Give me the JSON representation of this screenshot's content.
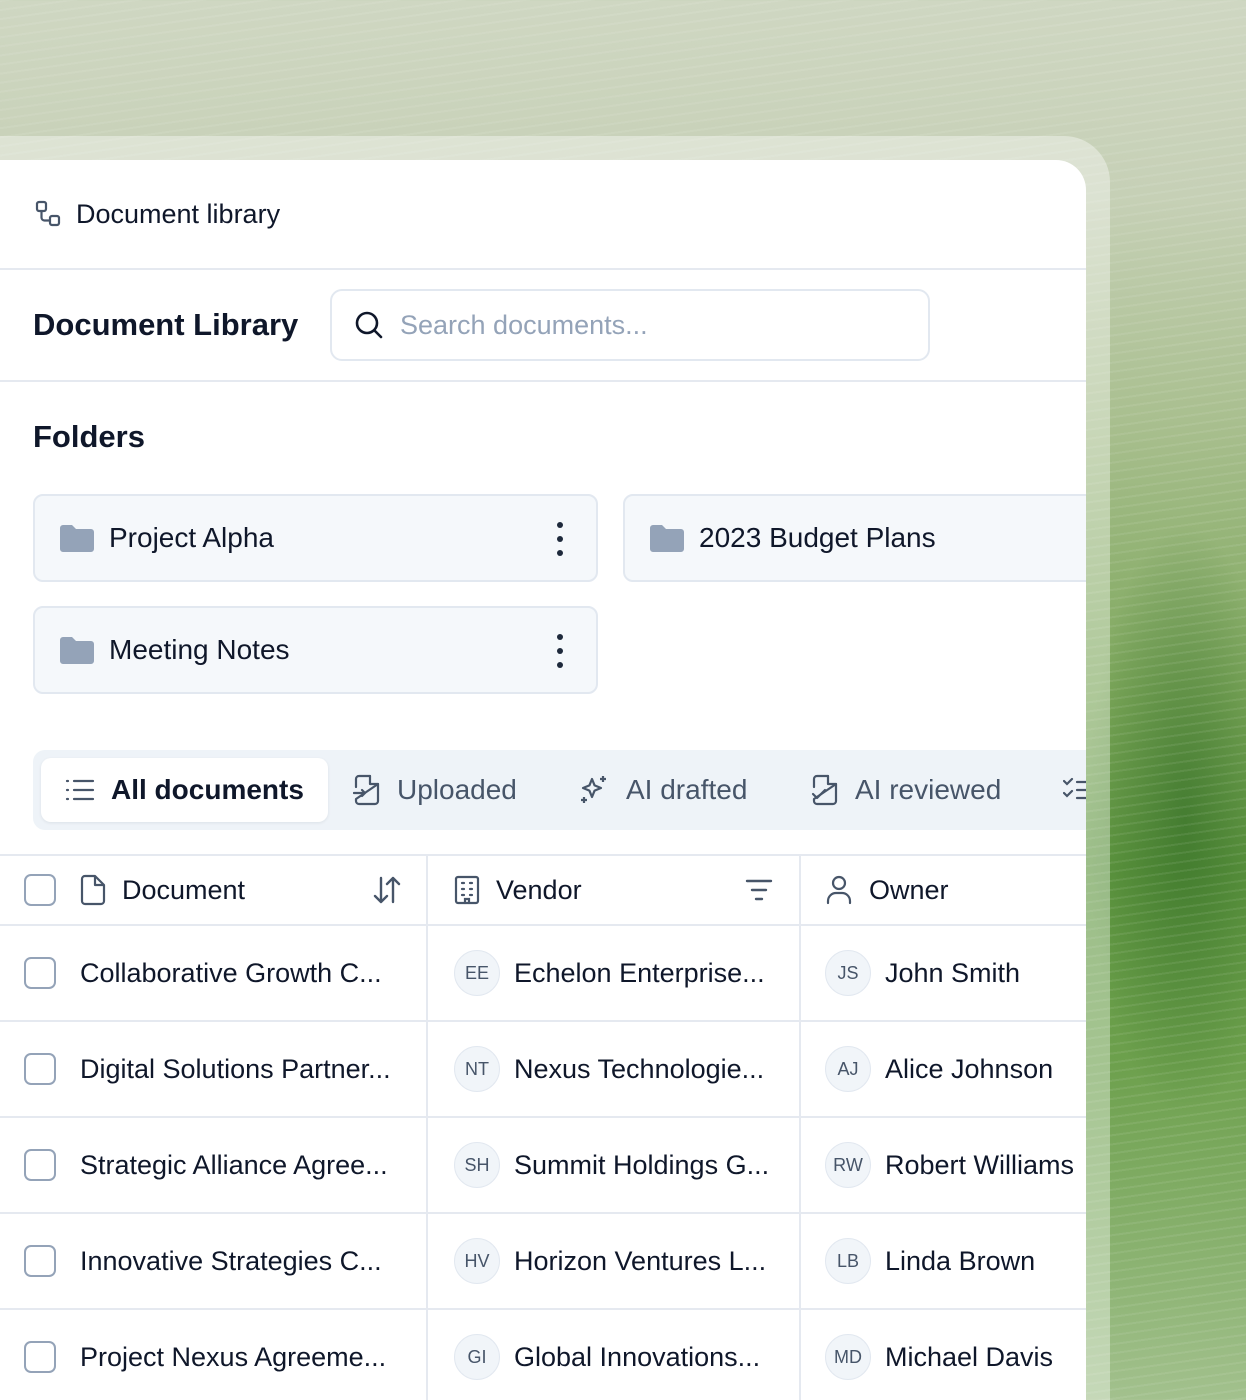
{
  "breadcrumb": {
    "label": "Document library"
  },
  "header": {
    "title": "Document Library",
    "search_placeholder": "Search documents..."
  },
  "folders": {
    "title": "Folders",
    "items": [
      {
        "name": "Project Alpha"
      },
      {
        "name": "2023 Budget Plans"
      },
      {
        "name": "Meeting Notes"
      }
    ]
  },
  "tabs": [
    {
      "label": "All documents",
      "icon": "list-icon",
      "active": true
    },
    {
      "label": "Uploaded",
      "icon": "file-upload-icon",
      "active": false
    },
    {
      "label": "AI drafted",
      "icon": "sparkle-icon",
      "active": false
    },
    {
      "label": "AI reviewed",
      "icon": "file-check-icon",
      "active": false
    }
  ],
  "table": {
    "columns": [
      {
        "label": "Document",
        "icon": "document-icon",
        "action": "sort-icon"
      },
      {
        "label": "Vendor",
        "icon": "building-icon",
        "action": "filter-icon"
      },
      {
        "label": "Owner",
        "icon": "user-icon"
      }
    ],
    "rows": [
      {
        "document": "Collaborative Growth C...",
        "vendor_initials": "EE",
        "vendor": "Echelon Enterprise...",
        "owner_initials": "JS",
        "owner": "John Smith"
      },
      {
        "document": "Digital Solutions Partner...",
        "vendor_initials": "NT",
        "vendor": "Nexus Technologie...",
        "owner_initials": "AJ",
        "owner": "Alice Johnson"
      },
      {
        "document": "Strategic Alliance Agree...",
        "vendor_initials": "SH",
        "vendor": "Summit Holdings G...",
        "owner_initials": "RW",
        "owner": "Robert Williams"
      },
      {
        "document": "Innovative Strategies C...",
        "vendor_initials": "HV",
        "vendor": "Horizon Ventures L...",
        "owner_initials": "LB",
        "owner": "Linda Brown"
      },
      {
        "document": "Project Nexus Agreeme...",
        "vendor_initials": "GI",
        "vendor": "Global Innovations...",
        "owner_initials": "MD",
        "owner": "Michael Davis"
      }
    ]
  }
}
